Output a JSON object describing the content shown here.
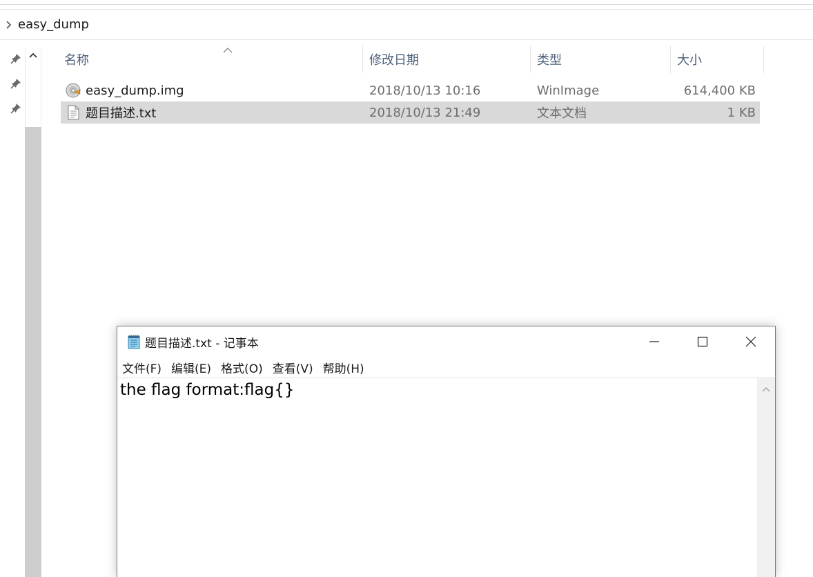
{
  "explorer": {
    "breadcrumb": "easy_dump",
    "columns": {
      "name": "名称",
      "date": "修改日期",
      "type": "类型",
      "size": "大小"
    },
    "files": [
      {
        "name": "easy_dump.img",
        "date": "2018/10/13 10:16",
        "type": "WinImage",
        "size": "614,400 KB",
        "icon": "disk-image-icon",
        "selected": false
      },
      {
        "name": "题目描述.txt",
        "date": "2018/10/13 21:49",
        "type": "文本文档",
        "size": "1 KB",
        "icon": "text-file-icon",
        "selected": true
      }
    ],
    "nav_pins": [
      "pin-icon",
      "pin-icon",
      "pin-icon"
    ],
    "colors": {
      "selected_row": "#d9d9d9",
      "header_text": "#4c607a",
      "meta_text": "#6d6d6d"
    }
  },
  "notepad": {
    "title": "题目描述.txt - 记事本",
    "menu": [
      "文件(F)",
      "编辑(E)",
      "格式(O)",
      "查看(V)",
      "帮助(H)"
    ],
    "content": "the flag format:flag{}",
    "buttons": [
      "minimize-icon",
      "maximize-icon",
      "close-icon"
    ]
  }
}
